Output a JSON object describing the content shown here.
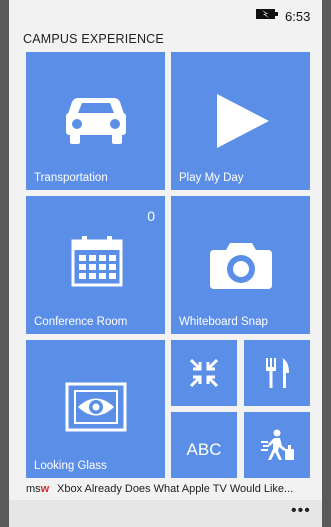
{
  "status": {
    "time": "6:53"
  },
  "app": {
    "title": "CAMPUS EXPERIENCE"
  },
  "tiles": {
    "transportation": {
      "label": "Transportation",
      "icon": "car-icon"
    },
    "play_my_day": {
      "label": "Play My Day",
      "icon": "play-icon"
    },
    "conference_room": {
      "label": "Conference Room",
      "count": "0",
      "icon": "calendar-icon"
    },
    "whiteboard_snap": {
      "label": "Whiteboard Snap",
      "icon": "camera-icon"
    },
    "looking_glass": {
      "label": "Looking Glass",
      "icon": "eye-icon"
    },
    "collapse": {
      "icon": "collapse-arrows-icon"
    },
    "dining": {
      "icon": "fork-knife-icon"
    },
    "abc": {
      "label": "ABC"
    },
    "travel": {
      "icon": "walking-luggage-icon"
    }
  },
  "ticker": {
    "source_ms": "ms",
    "source_w": "w",
    "text": "Xbox Already Does What Apple TV Would Like..."
  },
  "appbar": {
    "more": "•••"
  },
  "colors": {
    "tile": "#5b8ee6",
    "background": "#f2f2f2",
    "source_accent": "#d62a2a"
  }
}
